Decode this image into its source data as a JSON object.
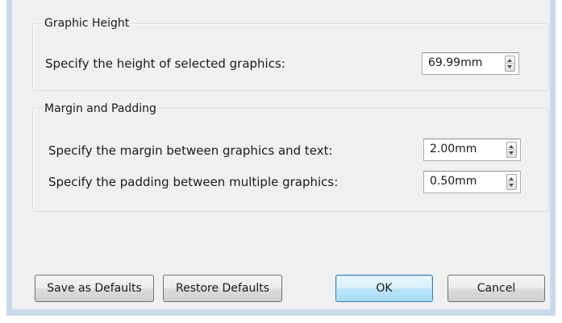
{
  "graphic_height": {
    "title": "Graphic Height",
    "height_label": "Specify the height of selected graphics:",
    "height_value": "69.99mm"
  },
  "margin_padding": {
    "title": "Margin and Padding",
    "margin_label": "Specify the margin between graphics and text:",
    "margin_value": "2.00mm",
    "padding_label": "Specify the padding between multiple graphics:",
    "padding_value": "0.50mm"
  },
  "buttons": {
    "save_defaults": "Save as Defaults",
    "restore_defaults": "Restore Defaults",
    "ok": "OK",
    "cancel": "Cancel"
  }
}
